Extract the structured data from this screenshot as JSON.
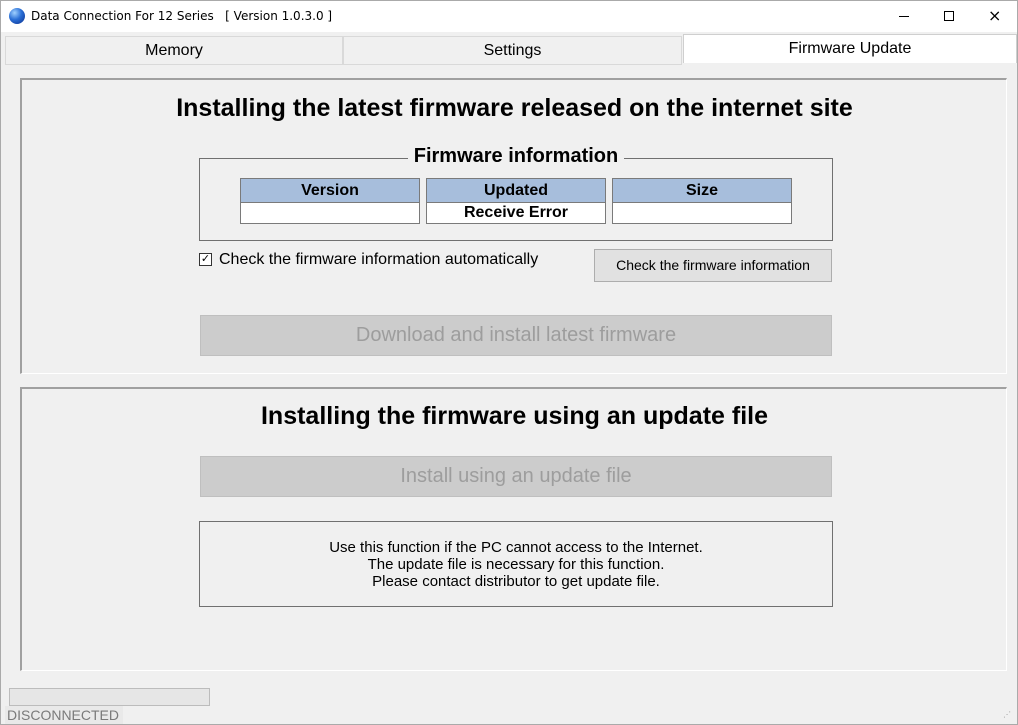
{
  "window": {
    "title": "Data Connection For 12 Series   [ Version 1.0.3.0 ]",
    "icon": "globe-icon",
    "controls": {
      "minimize": "minimize-icon",
      "maximize": "maximize-icon",
      "close": "×"
    }
  },
  "tabs": [
    {
      "label": "Memory",
      "active": false
    },
    {
      "label": "Settings",
      "active": false
    },
    {
      "label": "Firmware Update",
      "active": true
    }
  ],
  "internet_section": {
    "heading": "Installing the latest firmware released on the internet site",
    "group_title": "Firmware information",
    "table": {
      "headers": [
        "Version",
        "Updated",
        "Size"
      ],
      "values": [
        "",
        "Receive Error",
        ""
      ],
      "header_color": "#a7bedc"
    },
    "auto_check": {
      "label": "Check the firmware information automatically",
      "checked": true,
      "mark": "✓"
    },
    "check_button": "Check the firmware information",
    "download_button": {
      "label": "Download and install latest firmware",
      "enabled": false
    }
  },
  "file_section": {
    "heading": "Installing the firmware using an update file",
    "install_button": {
      "label": "Install using an update file",
      "enabled": false
    },
    "info_lines": [
      "Use this function if the PC cannot access to the Internet.",
      "The update file is necessary for this function.",
      "Please contact distributor to get update file."
    ]
  },
  "status_bar": {
    "connection": "DISCONNECTED",
    "progress": 0
  }
}
